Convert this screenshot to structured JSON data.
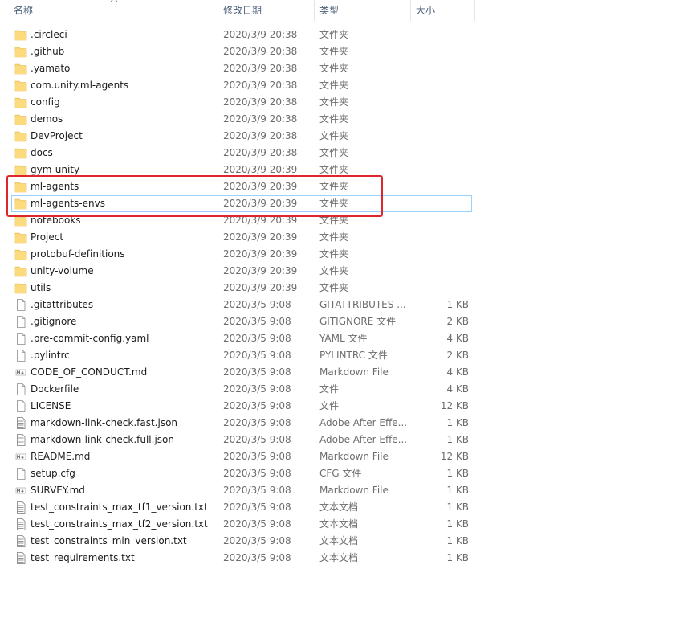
{
  "columns": {
    "name": "名称",
    "modified": "修改日期",
    "type": "类型",
    "size": "大小"
  },
  "files": [
    {
      "name": ".circleci",
      "modified": "2020/3/9 20:38",
      "type": "文件夹",
      "size": "",
      "icon": "folder-icon"
    },
    {
      "name": ".github",
      "modified": "2020/3/9 20:38",
      "type": "文件夹",
      "size": "",
      "icon": "folder-icon"
    },
    {
      "name": ".yamato",
      "modified": "2020/3/9 20:38",
      "type": "文件夹",
      "size": "",
      "icon": "folder-icon"
    },
    {
      "name": "com.unity.ml-agents",
      "modified": "2020/3/9 20:38",
      "type": "文件夹",
      "size": "",
      "icon": "folder-icon"
    },
    {
      "name": "config",
      "modified": "2020/3/9 20:38",
      "type": "文件夹",
      "size": "",
      "icon": "folder-icon"
    },
    {
      "name": "demos",
      "modified": "2020/3/9 20:38",
      "type": "文件夹",
      "size": "",
      "icon": "folder-icon"
    },
    {
      "name": "DevProject",
      "modified": "2020/3/9 20:38",
      "type": "文件夹",
      "size": "",
      "icon": "folder-icon"
    },
    {
      "name": "docs",
      "modified": "2020/3/9 20:38",
      "type": "文件夹",
      "size": "",
      "icon": "folder-icon"
    },
    {
      "name": "gym-unity",
      "modified": "2020/3/9 20:39",
      "type": "文件夹",
      "size": "",
      "icon": "folder-icon"
    },
    {
      "name": "ml-agents",
      "modified": "2020/3/9 20:39",
      "type": "文件夹",
      "size": "",
      "icon": "folder-icon"
    },
    {
      "name": "ml-agents-envs",
      "modified": "2020/3/9 20:39",
      "type": "文件夹",
      "size": "",
      "icon": "folder-icon"
    },
    {
      "name": "notebooks",
      "modified": "2020/3/9 20:39",
      "type": "文件夹",
      "size": "",
      "icon": "folder-icon"
    },
    {
      "name": "Project",
      "modified": "2020/3/9 20:39",
      "type": "文件夹",
      "size": "",
      "icon": "folder-icon"
    },
    {
      "name": "protobuf-definitions",
      "modified": "2020/3/9 20:39",
      "type": "文件夹",
      "size": "",
      "icon": "folder-icon"
    },
    {
      "name": "unity-volume",
      "modified": "2020/3/9 20:39",
      "type": "文件夹",
      "size": "",
      "icon": "folder-icon"
    },
    {
      "name": "utils",
      "modified": "2020/3/9 20:39",
      "type": "文件夹",
      "size": "",
      "icon": "folder-icon"
    },
    {
      "name": ".gitattributes",
      "modified": "2020/3/5 9:08",
      "type": "GITATTRIBUTES ...",
      "size": "1 KB",
      "icon": "file-icon"
    },
    {
      "name": ".gitignore",
      "modified": "2020/3/5 9:08",
      "type": "GITIGNORE 文件",
      "size": "2 KB",
      "icon": "file-icon"
    },
    {
      "name": ".pre-commit-config.yaml",
      "modified": "2020/3/5 9:08",
      "type": "YAML 文件",
      "size": "4 KB",
      "icon": "file-icon"
    },
    {
      "name": ".pylintrc",
      "modified": "2020/3/5 9:08",
      "type": "PYLINTRC 文件",
      "size": "2 KB",
      "icon": "file-icon"
    },
    {
      "name": "CODE_OF_CONDUCT.md",
      "modified": "2020/3/5 9:08",
      "type": "Markdown File",
      "size": "4 KB",
      "icon": "markdown-icon"
    },
    {
      "name": "Dockerfile",
      "modified": "2020/3/5 9:08",
      "type": "文件",
      "size": "4 KB",
      "icon": "file-icon"
    },
    {
      "name": "LICENSE",
      "modified": "2020/3/5 9:08",
      "type": "文件",
      "size": "12 KB",
      "icon": "file-icon"
    },
    {
      "name": "markdown-link-check.fast.json",
      "modified": "2020/3/5 9:08",
      "type": "Adobe After Effe...",
      "size": "1 KB",
      "icon": "text-file-icon"
    },
    {
      "name": "markdown-link-check.full.json",
      "modified": "2020/3/5 9:08",
      "type": "Adobe After Effe...",
      "size": "1 KB",
      "icon": "text-file-icon"
    },
    {
      "name": "README.md",
      "modified": "2020/3/5 9:08",
      "type": "Markdown File",
      "size": "12 KB",
      "icon": "markdown-icon"
    },
    {
      "name": "setup.cfg",
      "modified": "2020/3/5 9:08",
      "type": "CFG 文件",
      "size": "1 KB",
      "icon": "file-icon"
    },
    {
      "name": "SURVEY.md",
      "modified": "2020/3/5 9:08",
      "type": "Markdown File",
      "size": "1 KB",
      "icon": "markdown-icon"
    },
    {
      "name": "test_constraints_max_tf1_version.txt",
      "modified": "2020/3/5 9:08",
      "type": "文本文档",
      "size": "1 KB",
      "icon": "text-file-icon"
    },
    {
      "name": "test_constraints_max_tf2_version.txt",
      "modified": "2020/3/5 9:08",
      "type": "文本文档",
      "size": "1 KB",
      "icon": "text-file-icon"
    },
    {
      "name": "test_constraints_min_version.txt",
      "modified": "2020/3/5 9:08",
      "type": "文本文档",
      "size": "1 KB",
      "icon": "text-file-icon"
    },
    {
      "name": "test_requirements.txt",
      "modified": "2020/3/5 9:08",
      "type": "文本文档",
      "size": "1 KB",
      "icon": "text-file-icon"
    }
  ],
  "colors": {
    "folder": "#f8d775",
    "highlight_box": "#e0262d",
    "selection_outline": "#99d1ff"
  }
}
